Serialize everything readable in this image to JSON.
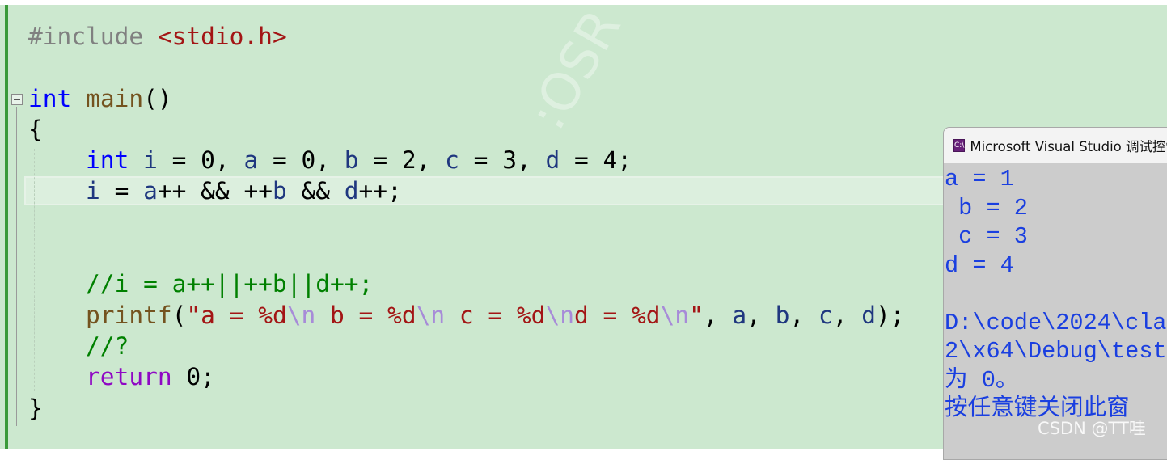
{
  "editor": {
    "watermark": ":OSR",
    "lines": [
      [
        [
          "#include ",
          "pp"
        ],
        [
          "<stdio.h>",
          "inc"
        ]
      ],
      [],
      [
        [
          "int",
          "kw"
        ],
        [
          " ",
          "pl"
        ],
        [
          "main",
          "fn"
        ],
        [
          "()",
          "pl"
        ]
      ],
      [
        [
          "{",
          "pl"
        ]
      ],
      [
        [
          "    ",
          "pl"
        ],
        [
          "int",
          "kw"
        ],
        [
          " ",
          "pl"
        ],
        [
          "i",
          "var"
        ],
        [
          " = 0, ",
          "pl"
        ],
        [
          "a",
          "var"
        ],
        [
          " = 0, ",
          "pl"
        ],
        [
          "b",
          "var"
        ],
        [
          " = 2, ",
          "pl"
        ],
        [
          "c",
          "var"
        ],
        [
          " = 3, ",
          "pl"
        ],
        [
          "d",
          "var"
        ],
        [
          " = 4;",
          "pl"
        ]
      ],
      [
        [
          "    ",
          "pl"
        ],
        [
          "i",
          "var"
        ],
        [
          " = ",
          "pl"
        ],
        [
          "a",
          "var"
        ],
        [
          "++ && ++",
          "pl"
        ],
        [
          "b",
          "var"
        ],
        [
          " && ",
          "pl"
        ],
        [
          "d",
          "var"
        ],
        [
          "++;",
          "pl"
        ]
      ],
      [],
      [],
      [
        [
          "    ",
          "pl"
        ],
        [
          "//i = a++||++b||d++;",
          "cm"
        ]
      ],
      [
        [
          "    ",
          "pl"
        ],
        [
          "printf",
          "fn"
        ],
        [
          "(",
          "pl"
        ],
        [
          "\"a = %d",
          "str"
        ],
        [
          "\\n",
          "esc"
        ],
        [
          " b = %d",
          "str"
        ],
        [
          "\\n",
          "esc"
        ],
        [
          " c = %d",
          "str"
        ],
        [
          "\\n",
          "esc"
        ],
        [
          "d = %d",
          "str"
        ],
        [
          "\\n",
          "esc"
        ],
        [
          "\"",
          "str"
        ],
        [
          ", ",
          "pl"
        ],
        [
          "a",
          "var"
        ],
        [
          ", ",
          "pl"
        ],
        [
          "b",
          "var"
        ],
        [
          ", ",
          "pl"
        ],
        [
          "c",
          "var"
        ],
        [
          ", ",
          "pl"
        ],
        [
          "d",
          "var"
        ],
        [
          ");",
          "pl"
        ]
      ],
      [
        [
          "    ",
          "pl"
        ],
        [
          "//?",
          "cm"
        ]
      ],
      [
        [
          "    ",
          "pl"
        ],
        [
          "return",
          "ret"
        ],
        [
          " 0;",
          "pl"
        ]
      ],
      [
        [
          "}",
          "pl"
        ]
      ]
    ]
  },
  "console": {
    "title": "Microsoft Visual Studio 调试控制台",
    "icon": "C:\\",
    "output": [
      "a = 1",
      " b = 2",
      " c = 3",
      "d = 4",
      "",
      "D:\\code\\2024\\cla",
      "2\\x64\\Debug\\test",
      "为 0。",
      "按任意键关闭此窗"
    ]
  },
  "watermark_site": "CSDN @TT哇"
}
